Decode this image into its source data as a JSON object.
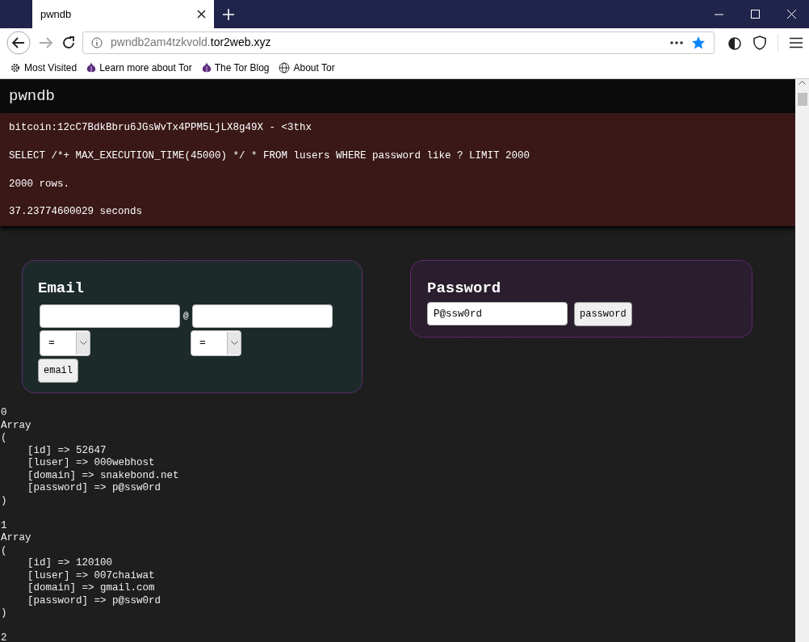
{
  "browser": {
    "tab_title": "pwndb",
    "url_host": "pwndb2am4tzkvold.",
    "url_domain": "tor2web.xyz",
    "bookmarks": [
      {
        "label": "Most Visited",
        "kind": "gear"
      },
      {
        "label": "Learn more about Tor",
        "kind": "onion"
      },
      {
        "label": "The Tor Blog",
        "kind": "onion"
      },
      {
        "label": "About Tor",
        "kind": "globe"
      }
    ]
  },
  "page": {
    "site_title": "pwndb",
    "info_lines": [
      "bitcoin:12cC7BdkBbru6JGsWvTx4PPM5LjLX8g49X - <3thx",
      "SELECT /*+ MAX_EXECUTION_TIME(45000) */ * FROM lusers WHERE password like ? LIMIT 2000",
      "2000 rows.",
      "37.23774600029 seconds"
    ],
    "email_form": {
      "title": "Email",
      "at_sign": "@",
      "user_operator": "=",
      "domain_operator": "=",
      "button": "email"
    },
    "password_form": {
      "title": "Password",
      "value": "P@ssw0rd",
      "button": "password"
    },
    "results": [
      {
        "index": "0",
        "label": "Array",
        "open": "(",
        "close": ")",
        "fields": [
          {
            "key": "[id] => ",
            "value": "52647"
          },
          {
            "key": "[luser] => ",
            "value": "000webhost"
          },
          {
            "key": "[domain] => ",
            "value": "snakebond.net"
          },
          {
            "key": "[password] => ",
            "value": "p@ssw0rd"
          }
        ]
      },
      {
        "index": "1",
        "label": "Array",
        "open": "(",
        "close": ")",
        "fields": [
          {
            "key": "[id] => ",
            "value": "120100"
          },
          {
            "key": "[luser] => ",
            "value": "007chaiwat"
          },
          {
            "key": "[domain] => ",
            "value": "gmail.com"
          },
          {
            "key": "[password] => ",
            "value": "p@ssw0rd"
          }
        ]
      },
      {
        "index": "2"
      }
    ]
  }
}
